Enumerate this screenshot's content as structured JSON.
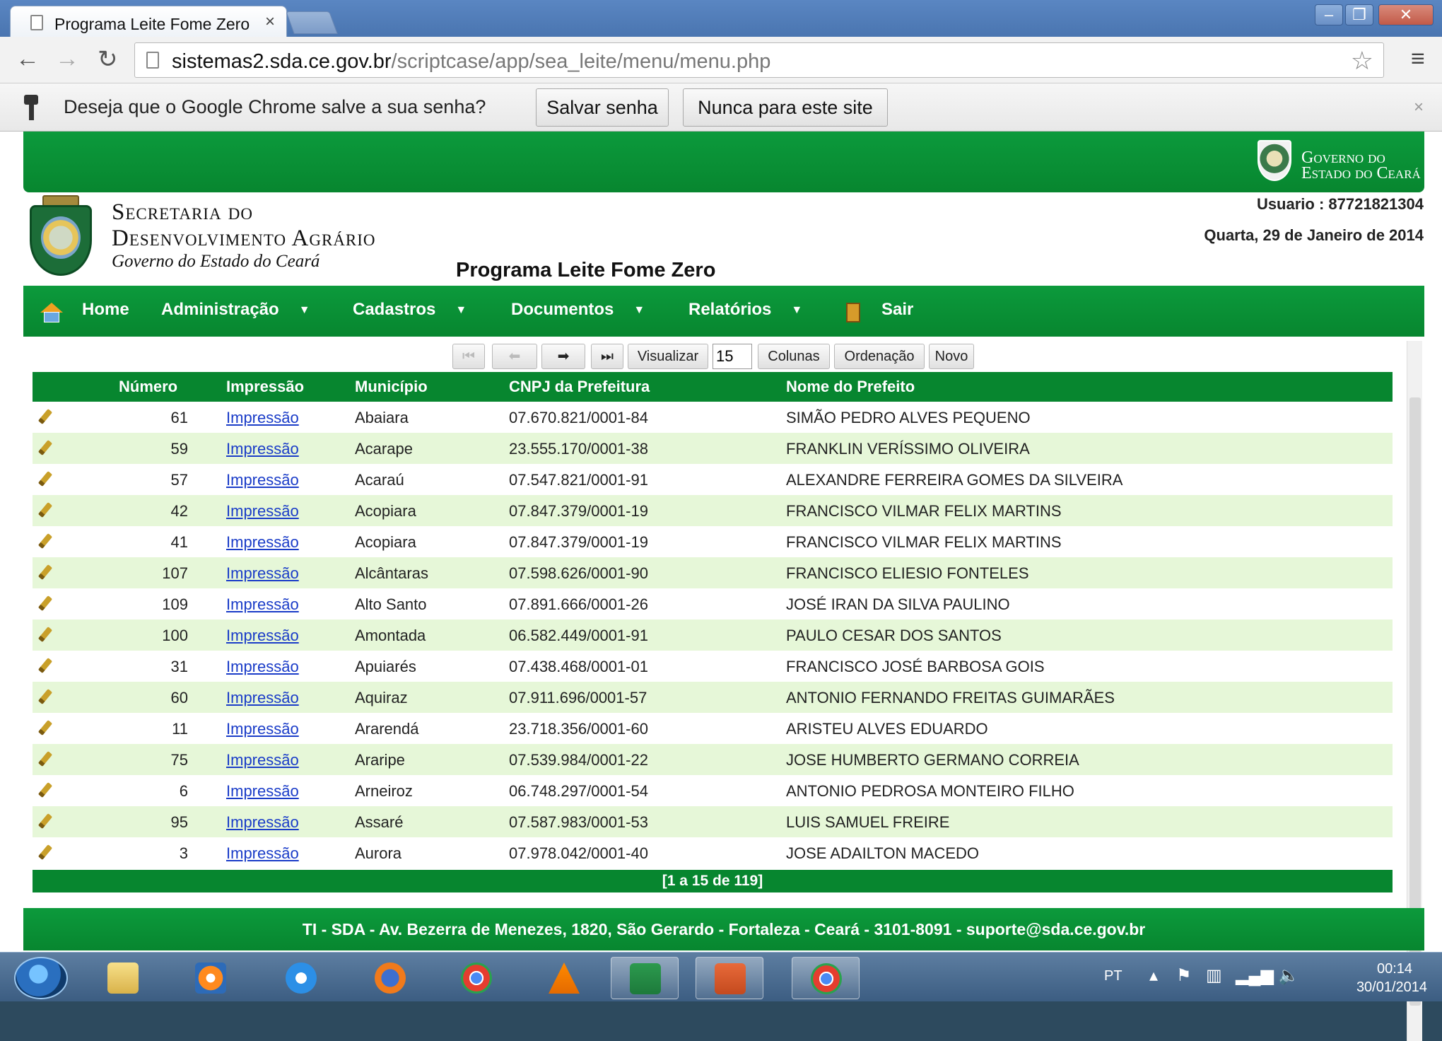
{
  "browser": {
    "tab_title": "Programa Leite Fome Zero",
    "tab_close": "×",
    "url_host": "sistemas2.sda.ce.gov.br",
    "url_path": "/scriptcase/app/sea_leite/menu/menu.php",
    "infobar_message": "Deseja que o Google Chrome salve a sua senha?",
    "save_password_label": "Salvar senha",
    "never_label": "Nunca para este site",
    "infobar_close": "×"
  },
  "header": {
    "gov_line1": "Governo do",
    "gov_line2": "Estado do Ceará",
    "sda_line1": "Secretaria do",
    "sda_line2": "Desenvolvimento  Agrário",
    "sda_line3": "Governo do Estado do Ceará",
    "user": "Usuario : 87721821304",
    "date": "Quarta, 29 de Janeiro de 2014",
    "program_title": "Programa Leite Fome Zero"
  },
  "nav": {
    "home": "Home",
    "admin": "Administração",
    "cadastros": "Cadastros",
    "documentos": "Documentos",
    "relatorios": "Relatórios",
    "sair": "Sair"
  },
  "grid_toolbar": {
    "visualizar": "Visualizar",
    "page_size": "15",
    "colunas": "Colunas",
    "ordenacao": "Ordenação",
    "novo": "Novo"
  },
  "table": {
    "columns": [
      "Número",
      "Impressão",
      "Município",
      "CNPJ da Prefeitura",
      "Nome do Prefeito"
    ],
    "rows": [
      {
        "num": "61",
        "imp": "Impressão",
        "mun": "Abaiara",
        "cnpj": "07.670.821/0001-84",
        "pref": "SIMÃO PEDRO ALVES PEQUENO"
      },
      {
        "num": "59",
        "imp": "Impressão",
        "mun": "Acarape",
        "cnpj": "23.555.170/0001-38",
        "pref": "FRANKLIN VERÍSSIMO OLIVEIRA"
      },
      {
        "num": "57",
        "imp": "Impressão",
        "mun": "Acaraú",
        "cnpj": "07.547.821/0001-91",
        "pref": "ALEXANDRE FERREIRA GOMES DA SILVEIRA"
      },
      {
        "num": "42",
        "imp": "Impressão",
        "mun": "Acopiara",
        "cnpj": "07.847.379/0001-19",
        "pref": "FRANCISCO VILMAR FELIX MARTINS"
      },
      {
        "num": "41",
        "imp": "Impressão",
        "mun": "Acopiara",
        "cnpj": "07.847.379/0001-19",
        "pref": "FRANCISCO VILMAR FELIX MARTINS"
      },
      {
        "num": "107",
        "imp": "Impressão",
        "mun": "Alcântaras",
        "cnpj": "07.598.626/0001-90",
        "pref": "FRANCISCO ELIESIO FONTELES"
      },
      {
        "num": "109",
        "imp": "Impressão",
        "mun": "Alto Santo",
        "cnpj": "07.891.666/0001-26",
        "pref": "JOSÉ IRAN DA SILVA PAULINO"
      },
      {
        "num": "100",
        "imp": "Impressão",
        "mun": "Amontada",
        "cnpj": "06.582.449/0001-91",
        "pref": "PAULO CESAR DOS SANTOS"
      },
      {
        "num": "31",
        "imp": "Impressão",
        "mun": "Apuiarés",
        "cnpj": "07.438.468/0001-01",
        "pref": "FRANCISCO JOSÉ BARBOSA GOIS"
      },
      {
        "num": "60",
        "imp": "Impressão",
        "mun": "Aquiraz",
        "cnpj": "07.911.696/0001-57",
        "pref": "ANTONIO FERNANDO FREITAS GUIMARÃES"
      },
      {
        "num": "11",
        "imp": "Impressão",
        "mun": "Ararendá",
        "cnpj": "23.718.356/0001-60",
        "pref": "ARISTEU ALVES EDUARDO"
      },
      {
        "num": "75",
        "imp": "Impressão",
        "mun": "Araripe",
        "cnpj": "07.539.984/0001-22",
        "pref": "JOSE HUMBERTO GERMANO CORREIA"
      },
      {
        "num": "6",
        "imp": "Impressão",
        "mun": "Arneiroz",
        "cnpj": "06.748.297/0001-54",
        "pref": "ANTONIO PEDROSA MONTEIRO FILHO"
      },
      {
        "num": "95",
        "imp": "Impressão",
        "mun": "Assaré",
        "cnpj": "07.587.983/0001-53",
        "pref": "LUIS SAMUEL FREIRE"
      },
      {
        "num": "3",
        "imp": "Impressão",
        "mun": "Aurora",
        "cnpj": "07.978.042/0001-40",
        "pref": "JOSE ADAILTON MACEDO"
      }
    ],
    "pagination": "[1 a 15 de 119]"
  },
  "footer": {
    "text": "TI - SDA - Av. Bezerra de Menezes, 1820, São Gerardo - Fortaleza - Ceará - 3101-8091 - suporte@sda.ce.gov.br"
  },
  "taskbar": {
    "lang": "PT",
    "time": "00:14",
    "date": "30/01/2014"
  },
  "colors": {
    "green": "#07862f",
    "row_alt": "#e6f7d8",
    "link": "#1a3cc8"
  }
}
